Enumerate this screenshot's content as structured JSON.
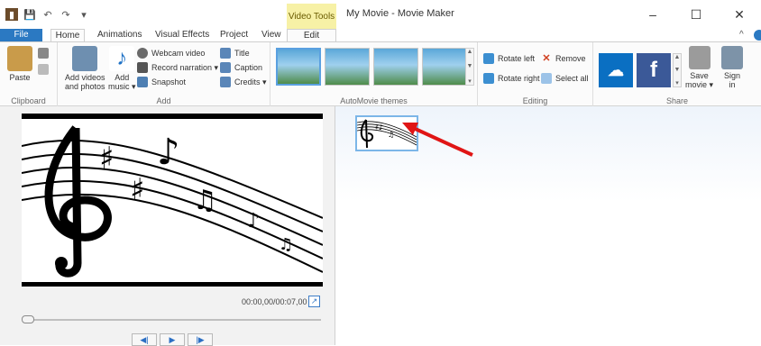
{
  "window": {
    "contextual_tab": "Video Tools",
    "title": "My Movie - Movie Maker",
    "min_glyph": "–",
    "max_glyph": "☐",
    "close_glyph": "✕"
  },
  "tabs": {
    "file": "File",
    "home": "Home",
    "animations": "Animations",
    "visual_effects": "Visual Effects",
    "project": "Project",
    "view": "View",
    "edit": "Edit"
  },
  "ribbon": {
    "clipboard": {
      "paste": "Paste",
      "group_label": "Clipboard"
    },
    "add": {
      "add_videos_line1": "Add videos",
      "add_videos_line2": "and photos",
      "add_music_line1": "Add",
      "add_music_line2": "music ▾",
      "webcam_video": "Webcam video",
      "record_narration": "Record narration ▾",
      "snapshot": "Snapshot",
      "title": "Title",
      "caption": "Caption",
      "credits": "Credits ▾",
      "group_label": "Add"
    },
    "themes": {
      "group_label": "AutoMovie themes"
    },
    "editing": {
      "rotate_left": "Rotate left",
      "rotate_right": "Rotate right",
      "remove": "Remove",
      "select_all": "Select all",
      "group_label": "Editing"
    },
    "share": {
      "save_movie_line1": "Save",
      "save_movie_line2": "movie ▾",
      "sign_in_line1": "Sign",
      "sign_in_line2": "in",
      "facebook_glyph": "f",
      "group_label": "Share"
    }
  },
  "preview": {
    "time": "00:00,00/00:07,00"
  },
  "colors": {
    "file_tab": "#2b79c2",
    "contextual_tab": "#f7f1a6",
    "onedrive": "#0a6fc2",
    "facebook": "#3b5998",
    "arrow": "#e01515"
  },
  "icons": [
    "paste-icon",
    "add-videos-icon",
    "add-music-icon",
    "webcam-icon",
    "narration-icon",
    "snapshot-icon",
    "title-icon",
    "caption-icon",
    "credits-icon",
    "rotate-left-icon",
    "rotate-right-icon",
    "remove-icon",
    "select-all-icon",
    "onedrive-icon",
    "facebook-icon",
    "save-movie-icon",
    "sign-in-icon",
    "expand-icon",
    "music-notes-image"
  ]
}
